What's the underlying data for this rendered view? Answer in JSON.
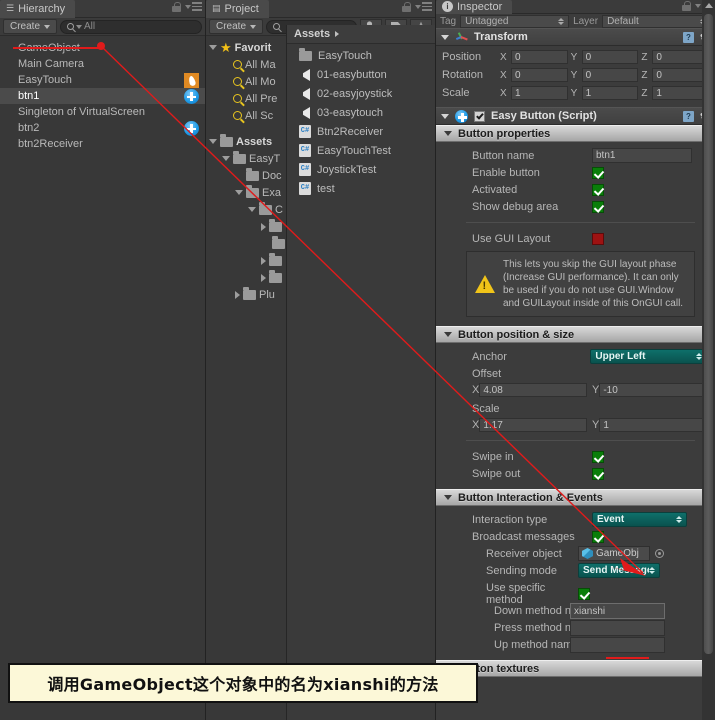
{
  "hierarchy": {
    "tab_title": "Hierarchy",
    "create_label": "Create",
    "search_placeholder": "All",
    "items": [
      {
        "label": "GameObject",
        "badge": "none",
        "selected": false,
        "underlined": true
      },
      {
        "label": "Main Camera",
        "badge": "none",
        "selected": false
      },
      {
        "label": "EasyTouch",
        "badge": "touch",
        "selected": false
      },
      {
        "label": "btn1",
        "badge": "plus",
        "selected": true
      },
      {
        "label": "Singleton of VirtualScreen",
        "badge": "none",
        "selected": false
      },
      {
        "label": "btn2",
        "badge": "plus",
        "selected": false
      },
      {
        "label": "btn2Receiver",
        "badge": "none",
        "selected": false
      }
    ]
  },
  "project": {
    "tab_title": "Project",
    "create_label": "Create",
    "search_placeholder": "",
    "toolbar_icons": [
      "shapes-filter-icon",
      "tag-icon",
      "star-icon"
    ],
    "tree": [
      {
        "label": "Favorit",
        "type": "star",
        "depth": 0,
        "expanded": true,
        "bold": true
      },
      {
        "label": "All Ma",
        "type": "search",
        "depth": 1
      },
      {
        "label": "All Mo",
        "type": "search",
        "depth": 1
      },
      {
        "label": "All Pre",
        "type": "search",
        "depth": 1
      },
      {
        "label": "All Sc",
        "type": "search",
        "depth": 1
      },
      {
        "label": "",
        "type": "spacer",
        "depth": 0
      },
      {
        "label": "Assets",
        "type": "folder",
        "depth": 0,
        "expanded": true,
        "bold": true
      },
      {
        "label": "EasyT",
        "type": "folder",
        "depth": 1,
        "expanded": true
      },
      {
        "label": "Doc",
        "type": "folder",
        "depth": 2
      },
      {
        "label": "Exa",
        "type": "folder",
        "depth": 2,
        "expanded": true
      },
      {
        "label": "C",
        "type": "folder",
        "depth": 3,
        "expanded": true
      },
      {
        "label": "",
        "type": "folder",
        "depth": 4,
        "collapsed": true
      },
      {
        "label": "",
        "type": "folder",
        "depth": 4
      },
      {
        "label": "",
        "type": "folder",
        "depth": 4,
        "collapsed": true
      },
      {
        "label": "",
        "type": "folder",
        "depth": 4,
        "collapsed": true
      },
      {
        "label": "Plu",
        "type": "folder",
        "depth": 2,
        "collapsed": true
      }
    ],
    "assets_pane": {
      "breadcrumb": "Assets",
      "items": [
        {
          "label": "EasyTouch",
          "icon": "folder-icon"
        },
        {
          "label": "01-easybutton",
          "icon": "scene-icon"
        },
        {
          "label": "02-easyjoystick",
          "icon": "scene-icon"
        },
        {
          "label": "03-easytouch",
          "icon": "scene-icon"
        },
        {
          "label": "Btn2Receiver",
          "icon": "csharp-script-icon"
        },
        {
          "label": "EasyTouchTest",
          "icon": "csharp-script-icon"
        },
        {
          "label": "JoystickTest",
          "icon": "csharp-script-icon"
        },
        {
          "label": "test",
          "icon": "csharp-script-icon"
        }
      ]
    }
  },
  "inspector": {
    "tab_title": "Inspector",
    "tag_label": "Tag",
    "tag_value": "Untagged",
    "layer_label": "Layer",
    "layer_value": "Default",
    "transform": {
      "title": "Transform",
      "rows": [
        {
          "label": "Position",
          "x": "0",
          "y": "0",
          "z": "0"
        },
        {
          "label": "Rotation",
          "x": "0",
          "y": "0",
          "z": "0"
        },
        {
          "label": "Scale",
          "x": "1",
          "y": "1",
          "z": "1"
        }
      ]
    },
    "easy_button": {
      "title": "Easy Button (Script)",
      "enabled": true
    },
    "button_properties": {
      "section_title": "Button properties",
      "button_name_label": "Button name",
      "button_name_value": "btn1",
      "enable_button_label": "Enable button",
      "enable_button_checked": true,
      "activated_label": "Activated",
      "activated_checked": true,
      "show_debug_label": "Show debug area",
      "show_debug_checked": true,
      "use_gui_layout_label": "Use GUI Layout",
      "use_gui_layout_checked": false,
      "help_text": "This lets you skip the GUI layout phase (Increase GUI performance). It can only be used if you do not use GUI.Window and GUILayout inside of this OnGUI call."
    },
    "button_position": {
      "section_title": "Button position & size",
      "anchor_label": "Anchor",
      "anchor_value": "Upper Left",
      "offset_label": "Offset",
      "offset_x": "4.08",
      "offset_y": "-10",
      "scale_label": "Scale",
      "scale_x": "1.17",
      "scale_y": "1",
      "swipe_in_label": "Swipe in",
      "swipe_in_checked": true,
      "swipe_out_label": "Swipe out",
      "swipe_out_checked": true
    },
    "button_interaction": {
      "section_title": "Button Interaction & Events",
      "interaction_type_label": "Interaction type",
      "interaction_type_value": "Event",
      "broadcast_label": "Broadcast messages",
      "broadcast_checked": true,
      "receiver_label": "Receiver object",
      "receiver_value": "GameObj",
      "sending_mode_label": "Sending mode",
      "sending_mode_value": "Send Message",
      "use_specific_label": "Use specific method",
      "use_specific_checked": true,
      "down_method_label": "Down method nam",
      "down_method_value": "xianshi",
      "press_method_label": "Press method nam",
      "press_method_value": "",
      "up_method_label": "Up method name",
      "up_method_value": ""
    },
    "button_textures": {
      "section_title": "Button textures"
    }
  },
  "annotation": {
    "note_text": "调用GameObject这个对象中的名为xianshi的方法",
    "arrow_color": "#e01b1b",
    "underline_color": "#e01b1b"
  }
}
